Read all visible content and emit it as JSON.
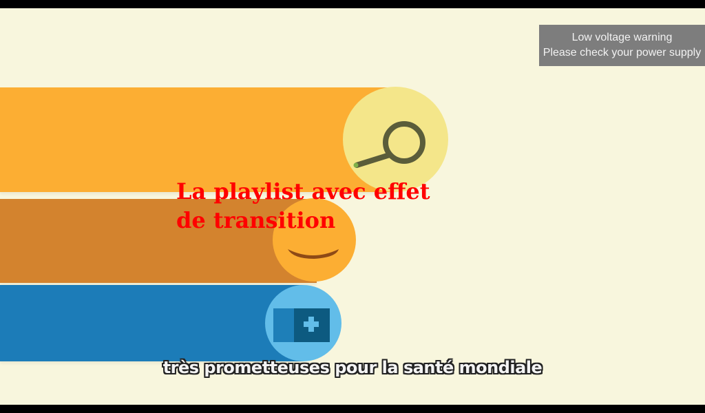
{
  "video": {
    "overlay_title": "La playlist avec effet de transition",
    "subtitle": "très prometteuses pour la santé mondiale"
  },
  "toast": {
    "line1": "Low voltage warning",
    "line2": "Please check your power supply"
  },
  "illustration": {
    "icons": [
      "magnifier-icon",
      "mouth-icon",
      "medical-kit-icon"
    ],
    "colors": {
      "background": "#f8f6dd",
      "orange_bar": "#fcae33",
      "brown_bar": "#d3832e",
      "blue_bar": "#1c7cb8",
      "search_circle": "#f4e68a",
      "kit_circle": "#62bde9",
      "title_text": "#ff0000",
      "toast_bg": "#7d7d7d"
    }
  }
}
